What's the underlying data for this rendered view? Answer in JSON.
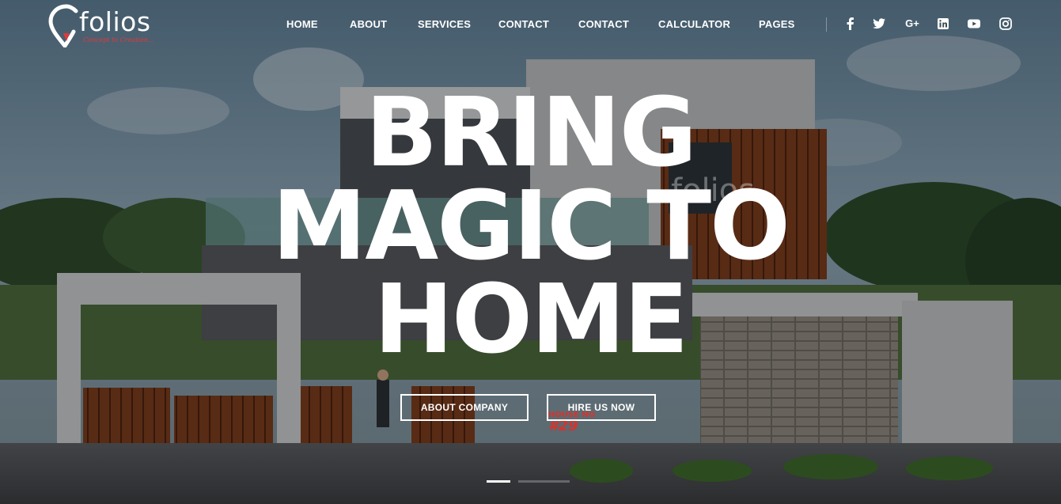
{
  "brand": {
    "logo_text": "folios",
    "tagline": "Concept to Creation..."
  },
  "nav": {
    "items": [
      {
        "label": "HOME"
      },
      {
        "label": "ABOUT"
      },
      {
        "label": "SERVICES"
      },
      {
        "label": "CONTACT"
      },
      {
        "label": "CONTACT"
      },
      {
        "label": "CALCULATOR"
      },
      {
        "label": "PAGES"
      }
    ]
  },
  "social": {
    "icons": [
      "facebook-icon",
      "twitter-icon",
      "google-plus-icon",
      "linkedin-icon",
      "youtube-icon",
      "instagram-icon"
    ],
    "google_plus_text": "G+"
  },
  "hero": {
    "line1": "BRING",
    "line2": "MAGIC TO",
    "line3": "HOME",
    "primary_button": "ABOUT COMPANY",
    "secondary_button": "HIRE US NOW",
    "watermark_text": "folios",
    "watermark_tagline": "Concept to Creation...",
    "house_no_label": "HOUSE NO",
    "house_no_value": "#29"
  },
  "slider": {
    "active_index": 0,
    "count": 2
  },
  "colors": {
    "text": "#ffffff",
    "accent_red": "#e03a3a"
  }
}
